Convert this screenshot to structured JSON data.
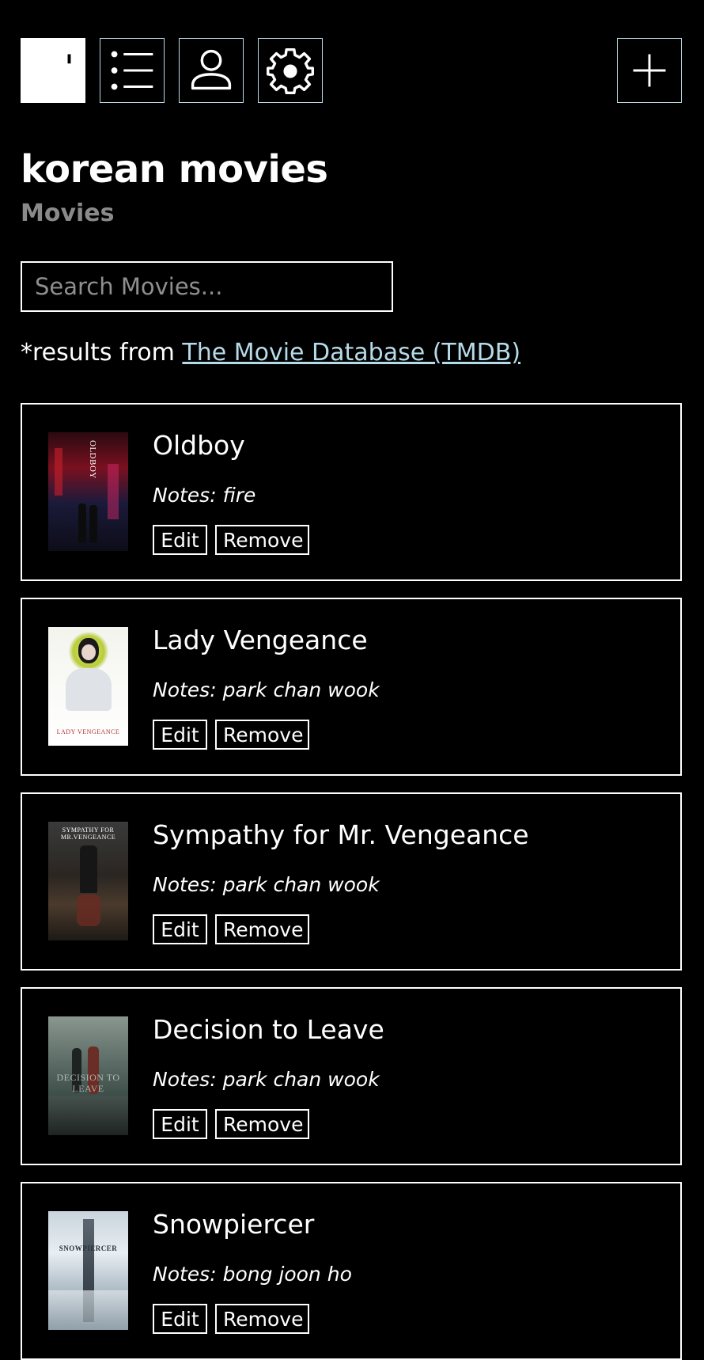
{
  "toolbar": {
    "logo_icon": "app-logo-icon",
    "list_icon": "list-icon",
    "user_icon": "user-icon",
    "settings_icon": "gear-icon",
    "add_icon": "plus-icon",
    "accent_color": "#b9dbe6"
  },
  "page": {
    "title": "korean movies",
    "subtitle": "Movies"
  },
  "search": {
    "placeholder": "Search Movies..."
  },
  "attribution": {
    "prefix": "*results from ",
    "link_text": "The Movie Database (TMDB)",
    "link_color": "#b6dbe8"
  },
  "movies": [
    {
      "title": "Oldboy",
      "notes": "Notes: fire",
      "poster_text": "OLDBOY",
      "edit_label": "Edit",
      "remove_label": "Remove"
    },
    {
      "title": "Lady Vengeance",
      "notes": "Notes: park chan wook",
      "poster_text": "LADY VENGEANCE",
      "edit_label": "Edit",
      "remove_label": "Remove"
    },
    {
      "title": "Sympathy for Mr. Vengeance",
      "notes": "Notes: park chan wook",
      "poster_text": "SYMPATHY FOR MR.VENGEANCE",
      "edit_label": "Edit",
      "remove_label": "Remove"
    },
    {
      "title": "Decision to Leave",
      "notes": "Notes: park chan wook",
      "poster_text": "DECISION TO LEAVE",
      "edit_label": "Edit",
      "remove_label": "Remove"
    },
    {
      "title": "Snowpiercer",
      "notes": "Notes: bong joon ho",
      "poster_text": "SNOWPIERCER",
      "edit_label": "Edit",
      "remove_label": "Remove"
    }
  ]
}
